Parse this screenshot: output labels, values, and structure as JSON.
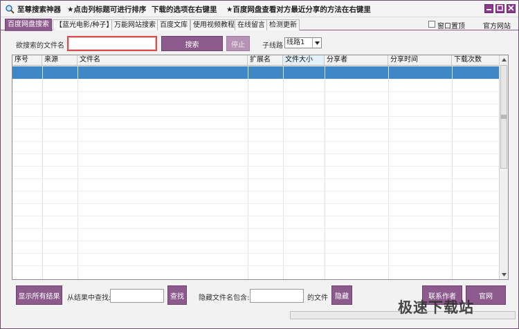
{
  "titlebar": {
    "app_title": "至尊搜索神器",
    "hint1": "★点击列标题可进行排序",
    "hint2": "下载的选项在右键里",
    "hint3": "★百度网盘查看对方最近分享的方法在右键里"
  },
  "tabs": [
    {
      "label": "百度网盘搜索",
      "active": true
    },
    {
      "label": "【蓝光电影/种子】",
      "active": false
    },
    {
      "label": "万能网站搜索",
      "active": false
    },
    {
      "label": "百度文库",
      "active": false
    },
    {
      "label": "使用视频教程",
      "active": false
    },
    {
      "label": "在线留言",
      "active": false
    },
    {
      "label": "检测更新",
      "active": false
    }
  ],
  "topright": {
    "topmost_label": "窗口置顶",
    "topmost_checked": false,
    "official_link": "官方网站"
  },
  "search": {
    "label": "欲搜索的文件名",
    "value": "",
    "placeholder": "",
    "search_button": "搜索",
    "stop_button": "停止",
    "line_label": "子线路",
    "line_selected": "线路1"
  },
  "table": {
    "columns": [
      "序号",
      "来源",
      "文件名",
      "扩展名",
      "文件大小",
      "分享者",
      "分享时间",
      "下载次数"
    ],
    "sorted_column": "文件大小",
    "rows": []
  },
  "bottom": {
    "show_all_button": "显示所有结果",
    "find_label": "从结果中查找:",
    "find_value": "",
    "find_button": "查找",
    "hide_label": "隐藏文件名包含:",
    "hide_value": "",
    "file_suffix_label": "的文件",
    "hide_button": "隐藏",
    "contact_button": "联系作者",
    "official_button": "官网"
  },
  "watermark": "极速下载站",
  "colors": {
    "accent": "#8c5a8c",
    "selection": "#3f86c6",
    "highlight_border": "#e04a4a"
  },
  "icons": {
    "app": "magnifier-icon",
    "minimize": "minimize-icon",
    "maximize": "maximize-icon",
    "close": "close-icon",
    "dropdown": "chevron-down-icon"
  }
}
